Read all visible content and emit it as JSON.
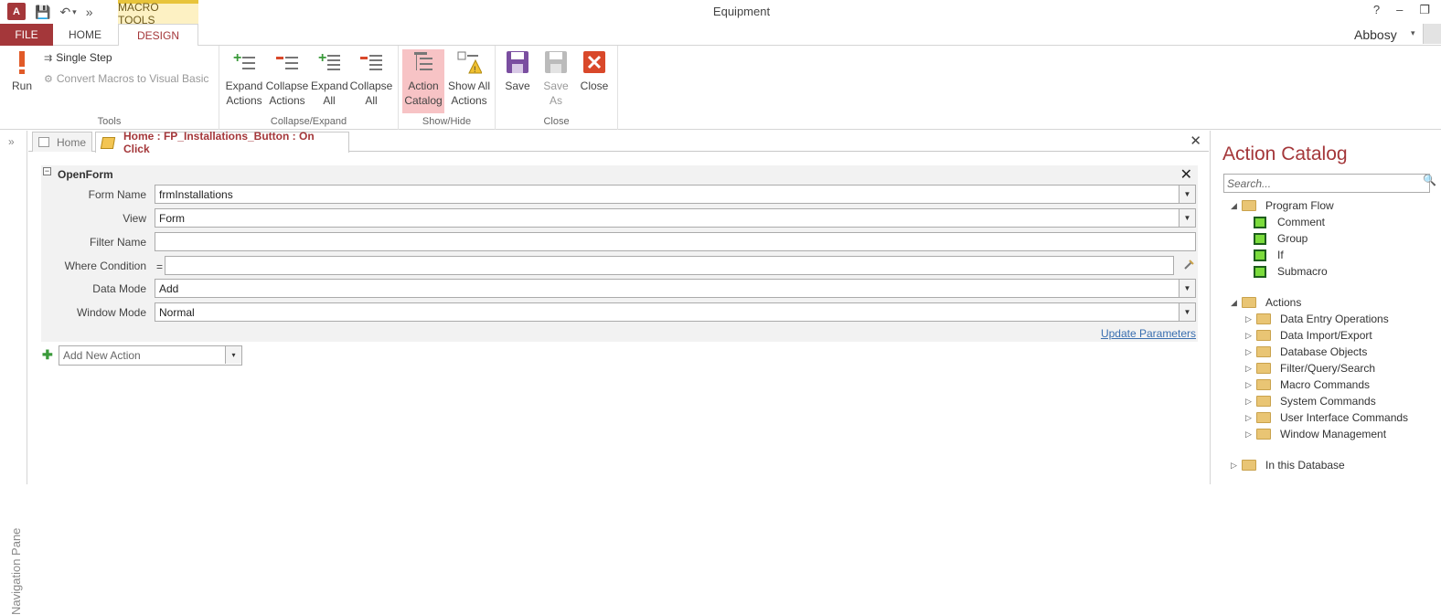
{
  "window": {
    "title": "Equipment",
    "app_icon": "A",
    "context_tab_header": "MACRO TOOLS",
    "help": "?",
    "minimize": "–",
    "restore": "❐"
  },
  "qat": {
    "save_icon": "💾",
    "undo_icon": "↶",
    "undo_caret": "▾",
    "more_icon": "»"
  },
  "tabs": {
    "file": "FILE",
    "home": "HOME",
    "design": "DESIGN"
  },
  "user": {
    "name": "Abbosy",
    "caret": "▾"
  },
  "ribbon": {
    "tools": {
      "label": "Tools",
      "run": "Run",
      "single_step": "Single Step",
      "convert": "Convert Macros to Visual Basic"
    },
    "collapse_expand": {
      "label": "Collapse/Expand",
      "expand_actions": [
        "Expand",
        "Actions"
      ],
      "collapse_actions": [
        "Collapse",
        "Actions"
      ],
      "expand_all": [
        "Expand",
        "All"
      ],
      "collapse_all": [
        "Collapse",
        "All"
      ]
    },
    "show_hide": {
      "label": "Show/Hide",
      "action_catalog": [
        "Action",
        "Catalog"
      ],
      "show_all_actions": [
        "Show All",
        "Actions"
      ]
    },
    "close_group": {
      "label": "Close",
      "save": "Save",
      "save_as": [
        "Save",
        "As"
      ],
      "close": "Close"
    }
  },
  "nav_pane": {
    "label": "Navigation Pane",
    "chevron": "»"
  },
  "doc_tabs": {
    "home": "Home",
    "macro": "Home : FP_Installations_Button : On Click",
    "close": "✕"
  },
  "action": {
    "name": "OpenForm",
    "close": "✕",
    "collapse": "−",
    "args": [
      {
        "label": "Form Name",
        "value": "frmInstallations",
        "dropdown": true
      },
      {
        "label": "View",
        "value": "Form",
        "dropdown": true
      },
      {
        "label": "Filter Name",
        "value": "",
        "dropdown": false
      },
      {
        "label": "Where Condition",
        "value": "",
        "dropdown": false
      },
      {
        "label": "Data Mode",
        "value": "Add",
        "dropdown": true
      },
      {
        "label": "Window Mode",
        "value": "Normal",
        "dropdown": true
      }
    ],
    "where_eq": "=",
    "update_parameters": "Update Parameters"
  },
  "add_action": {
    "plus": "✚",
    "placeholder": "Add New Action",
    "caret": "▾"
  },
  "catalog": {
    "title": "Action Catalog",
    "search_placeholder": "Search...",
    "search_icon": "🔍",
    "program_flow": "Program Flow",
    "program_flow_items": [
      "Comment",
      "Group",
      "If",
      "Submacro"
    ],
    "actions": "Actions",
    "action_folders": [
      "Data Entry Operations",
      "Data Import/Export",
      "Database Objects",
      "Filter/Query/Search",
      "Macro Commands",
      "System Commands",
      "User Interface Commands",
      "Window Management"
    ],
    "in_this_database": "In this Database"
  },
  "colors": {
    "accent": "#a4373a",
    "context_tab": "#fdf1c3",
    "active_button": "#f7c3c5"
  }
}
